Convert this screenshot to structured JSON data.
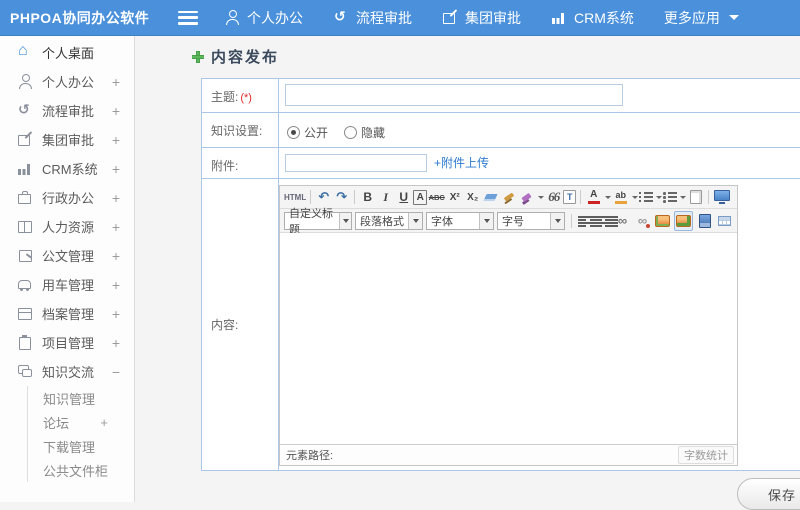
{
  "app": {
    "logo": "PHPOA协同办公软件"
  },
  "topnav": {
    "items": [
      {
        "label": "个人办公",
        "icon": "person-icon"
      },
      {
        "label": "流程审批",
        "icon": "process-arrow-icon"
      },
      {
        "label": "集团审批",
        "icon": "compose-icon"
      },
      {
        "label": "CRM系统",
        "icon": "bar-chart-icon"
      },
      {
        "label": "更多应用",
        "icon": "caret-down-icon"
      }
    ]
  },
  "sidebar": {
    "items": [
      {
        "label": "个人桌面",
        "icon": "home-icon",
        "expand": "",
        "active": true
      },
      {
        "label": "个人办公",
        "icon": "person-icon",
        "expand": "+"
      },
      {
        "label": "流程审批",
        "icon": "process-arrow-icon",
        "expand": "+"
      },
      {
        "label": "集团审批",
        "icon": "compose-icon",
        "expand": "+"
      },
      {
        "label": "CRM系统",
        "icon": "bar-chart-icon",
        "expand": "+"
      },
      {
        "label": "行政办公",
        "icon": "briefcase-icon",
        "expand": "+"
      },
      {
        "label": "人力资源",
        "icon": "book-icon",
        "expand": "+"
      },
      {
        "label": "公文管理",
        "icon": "document-icon",
        "expand": "+"
      },
      {
        "label": "用车管理",
        "icon": "car-icon",
        "expand": "+"
      },
      {
        "label": "档案管理",
        "icon": "archive-icon",
        "expand": "+"
      },
      {
        "label": "项目管理",
        "icon": "clipboard-icon",
        "expand": "+"
      },
      {
        "label": "知识交流",
        "icon": "chat-icon",
        "expand": "−"
      }
    ],
    "subitems": [
      {
        "label": "知识管理",
        "expand": ""
      },
      {
        "label": "论坛",
        "expand": "+"
      },
      {
        "label": "下载管理",
        "expand": ""
      },
      {
        "label": "公共文件柜",
        "expand": ""
      }
    ]
  },
  "page": {
    "title": "内容发布"
  },
  "form": {
    "subject": {
      "label": "主题:",
      "required": "(*)",
      "value": ""
    },
    "knowledge": {
      "label": "知识设置:",
      "options": [
        {
          "label": "公开",
          "selected": true
        },
        {
          "label": "隐藏",
          "selected": false
        }
      ]
    },
    "attachment": {
      "label": "附件:",
      "value": "",
      "upload_link": "+附件上传"
    },
    "content": {
      "label": "内容:",
      "value": ""
    }
  },
  "editor": {
    "toolbar1": {
      "html": "HTML",
      "bold": "B",
      "italic": "I",
      "underline": "U",
      "font_box": "A",
      "strike": "ABC",
      "sup": "X²",
      "sub": "X₂",
      "quote": "66",
      "paste": "T",
      "font_color": "A",
      "highlight": "ab"
    },
    "toolbar2": {
      "heading_select": "自定义标题",
      "paragraph_select": "段落格式",
      "font_select": "字体",
      "size_select": "字号"
    },
    "statusbar": {
      "path_label": "元素路径:",
      "word_count": "字数统计"
    }
  },
  "actions": {
    "save": "保存"
  },
  "colors": {
    "topbar": "#4a90da",
    "accent_green": "#5cb85c",
    "link": "#2e7bd0",
    "form_border": "#aac8e6",
    "required": "#e02b2b"
  }
}
